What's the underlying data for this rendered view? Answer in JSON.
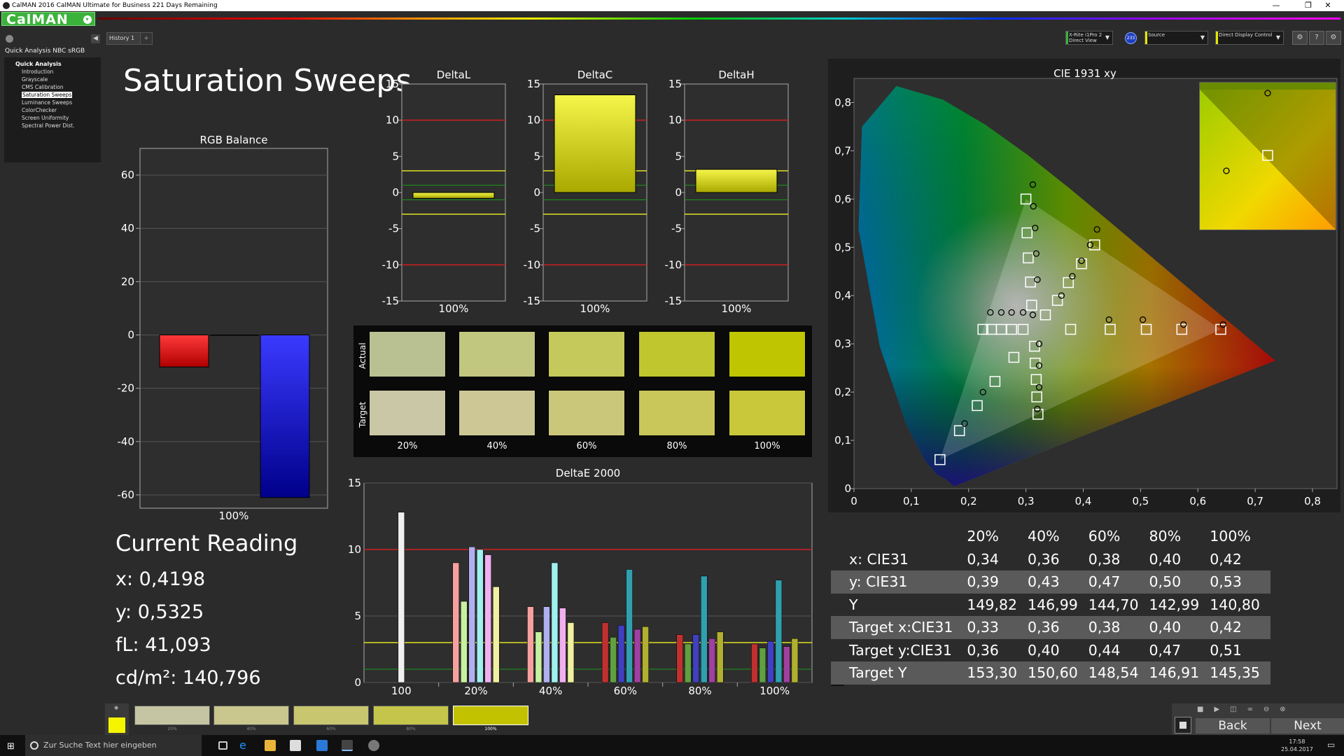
{
  "window": {
    "title": "CalMAN 2016 CalMAN Ultimate for Business 221 Days Remaining",
    "min": "—",
    "max": "❐",
    "close": "✕"
  },
  "logo": {
    "text": "CalMAN",
    "dropdown": "▾"
  },
  "toolbar": {
    "history_tab": "History 1",
    "add_tab": "+",
    "meter_line1": "X-Rite i1Pro 2",
    "meter_line2": "Direct View",
    "meter_badge": "233",
    "source_label": "Source",
    "display_label": "Direct Display Control",
    "meter_color": "#3bb33b",
    "source_color": "#e6e600",
    "display_color": "#e6e600"
  },
  "sidebar": {
    "project": "Quick Analysis NBC sRGB",
    "section": "Quick Analysis",
    "items": [
      "Introduction",
      "Grayscale",
      "CMS Calibration",
      "Saturation Sweeps",
      "Luminance Sweeps",
      "ColorChecker",
      "Screen Uniformity",
      "Spectral Power Dist."
    ],
    "selected_index": 3
  },
  "page": {
    "title": "Saturation Sweeps"
  },
  "rgb_balance": {
    "title": "RGB Balance",
    "xlabel": "100%",
    "ticks": [
      "60",
      "40",
      "20",
      "0",
      "-20",
      "-40",
      "-60"
    ]
  },
  "delta_l": {
    "title": "DeltaL",
    "xlabel": "100%"
  },
  "delta_c": {
    "title": "DeltaC",
    "xlabel": "100%"
  },
  "delta_h": {
    "title": "DeltaH",
    "xlabel": "100%"
  },
  "delta_ticks": [
    "15",
    "10",
    "5",
    "0",
    "-5",
    "-10",
    "-15"
  ],
  "swatches": {
    "actual_label": "Actual",
    "target_label": "Target",
    "labels": [
      "20%",
      "40%",
      "60%",
      "80%",
      "100%"
    ],
    "actual": [
      "#b9c193",
      "#c2c77f",
      "#c5c85a",
      "#c0c62e",
      "#bfc500"
    ],
    "target": [
      "#c9c7a5",
      "#cdc795",
      "#cbc77a",
      "#c9c759",
      "#c8c83a"
    ]
  },
  "deltae": {
    "title": "DeltaE 2000",
    "ticks": [
      "15",
      "10",
      "5",
      "0"
    ],
    "xlabels": [
      "100",
      "20%",
      "40%",
      "60%",
      "80%",
      "100%"
    ]
  },
  "cie": {
    "title": "CIE 1931 xy",
    "xticks": [
      "0",
      "0,1",
      "0,2",
      "0,3",
      "0,4",
      "0,5",
      "0,6",
      "0,7",
      "0,8"
    ],
    "yticks": [
      "0,8",
      "0,7",
      "0,6",
      "0,5",
      "0,4",
      "0,3",
      "0,2",
      "0,1",
      "0"
    ]
  },
  "current_reading": {
    "heading": "Current Reading",
    "x": "x: 0,4198",
    "y": "y: 0,5325",
    "fl": "fL: 41,093",
    "cdm2": "cd/m²: 140,796"
  },
  "table": {
    "headers": [
      "20%",
      "40%",
      "60%",
      "80%",
      "100%"
    ],
    "rows": [
      {
        "label": "x: CIE31",
        "values": [
          "0,34",
          "0,36",
          "0,38",
          "0,40",
          "0,42"
        ]
      },
      {
        "label": "y: CIE31",
        "values": [
          "0,39",
          "0,43",
          "0,47",
          "0,50",
          "0,53"
        ]
      },
      {
        "label": "Y",
        "values": [
          "149,82",
          "146,99",
          "144,70",
          "142,99",
          "140,80"
        ]
      },
      {
        "label": "Target x:CIE31",
        "values": [
          "0,33",
          "0,36",
          "0,38",
          "0,40",
          "0,42"
        ]
      },
      {
        "label": "Target y:CIE31",
        "values": [
          "0,36",
          "0,40",
          "0,44",
          "0,47",
          "0,51"
        ]
      },
      {
        "label": "Target Y",
        "values": [
          "153,30",
          "150,60",
          "148,54",
          "146,91",
          "145,35"
        ]
      }
    ]
  },
  "bottom": {
    "swatch_labels": [
      "20%",
      "40%",
      "60%",
      "80%",
      "100%"
    ],
    "swatch_colors": [
      "#c5c5a3",
      "#c9c68e",
      "#c8c66e",
      "#c5c54b",
      "#c2c200"
    ],
    "current_color": "#f5f500",
    "back": "Back",
    "next": "Next"
  },
  "taskbar": {
    "search_placeholder": "Zur Suche Text hier eingeben",
    "time": "17:58",
    "date": "25.04.2017"
  },
  "chart_data": [
    {
      "type": "bar",
      "title": "RGB Balance",
      "categories": [
        "100%"
      ],
      "series": [
        {
          "name": "Red",
          "values": [
            -12
          ]
        },
        {
          "name": "Green",
          "values": [
            0
          ]
        },
        {
          "name": "Blue",
          "values": [
            -61
          ]
        }
      ],
      "ylim": [
        -65,
        70
      ]
    },
    {
      "type": "bar",
      "title": "DeltaL",
      "categories": [
        "100%"
      ],
      "values": [
        -0.8
      ],
      "ylim": [
        -15,
        15
      ]
    },
    {
      "type": "bar",
      "title": "DeltaC",
      "categories": [
        "100%"
      ],
      "values": [
        13.5
      ],
      "ylim": [
        -15,
        15
      ]
    },
    {
      "type": "bar",
      "title": "DeltaH",
      "categories": [
        "100%"
      ],
      "values": [
        3.2
      ],
      "ylim": [
        -15,
        15
      ]
    },
    {
      "type": "bar",
      "title": "DeltaE 2000",
      "categories": [
        "100",
        "20%",
        "40%",
        "60%",
        "80%",
        "100%"
      ],
      "series": [
        {
          "name": "White",
          "values": [
            12.8,
            null,
            null,
            null,
            null,
            null
          ]
        },
        {
          "name": "Red",
          "values": [
            null,
            9,
            5.7,
            4.5,
            3.6,
            2.9
          ]
        },
        {
          "name": "Green",
          "values": [
            null,
            6.1,
            3.8,
            3.4,
            2.9,
            2.6
          ]
        },
        {
          "name": "Blue",
          "values": [
            null,
            10.2,
            5.7,
            4.3,
            3.6,
            3.1
          ]
        },
        {
          "name": "Cyan",
          "values": [
            null,
            10,
            9,
            8.5,
            8,
            7.7
          ]
        },
        {
          "name": "Magenta",
          "values": [
            null,
            9.6,
            5.6,
            4,
            3.3,
            2.7
          ]
        },
        {
          "name": "Yellow",
          "values": [
            null,
            7.2,
            4.5,
            4.2,
            3.8,
            3.3
          ]
        }
      ],
      "ylim": [
        0,
        15
      ]
    },
    {
      "type": "scatter",
      "title": "CIE 1931 xy",
      "xlim": [
        0,
        0.8
      ],
      "ylim": [
        0,
        0.85
      ],
      "gamut": [
        [
          0.64,
          0.33
        ],
        [
          0.3,
          0.6
        ],
        [
          0.15,
          0.06
        ]
      ],
      "targets": [
        [
          0.64,
          0.33
        ],
        [
          0.572,
          0.33
        ],
        [
          0.51,
          0.33
        ],
        [
          0.447,
          0.33
        ],
        [
          0.378,
          0.33
        ],
        [
          0.3,
          0.6
        ],
        [
          0.302,
          0.53
        ],
        [
          0.304,
          0.478
        ],
        [
          0.308,
          0.428
        ],
        [
          0.31,
          0.38
        ],
        [
          0.15,
          0.06
        ],
        [
          0.184,
          0.12
        ],
        [
          0.215,
          0.172
        ],
        [
          0.246,
          0.222
        ],
        [
          0.279,
          0.272
        ],
        [
          0.42,
          0.505
        ],
        [
          0.397,
          0.466
        ],
        [
          0.374,
          0.427
        ],
        [
          0.355,
          0.39
        ],
        [
          0.334,
          0.36
        ],
        [
          0.225,
          0.33
        ],
        [
          0.24,
          0.33
        ],
        [
          0.257,
          0.33
        ],
        [
          0.275,
          0.33
        ],
        [
          0.295,
          0.33
        ],
        [
          0.321,
          0.154
        ],
        [
          0.319,
          0.19
        ],
        [
          0.318,
          0.226
        ],
        [
          0.316,
          0.26
        ],
        [
          0.315,
          0.295
        ]
      ],
      "measured": [
        [
          0.644,
          0.34
        ],
        [
          0.575,
          0.34
        ],
        [
          0.504,
          0.35
        ],
        [
          0.445,
          0.35
        ],
        [
          0.312,
          0.63
        ],
        [
          0.313,
          0.585
        ],
        [
          0.316,
          0.54
        ],
        [
          0.318,
          0.487
        ],
        [
          0.32,
          0.433
        ],
        [
          0.312,
          0.36
        ],
        [
          0.193,
          0.135
        ],
        [
          0.225,
          0.2
        ],
        [
          0.424,
          0.537
        ],
        [
          0.412,
          0.505
        ],
        [
          0.397,
          0.472
        ],
        [
          0.381,
          0.44
        ],
        [
          0.362,
          0.4
        ],
        [
          0.238,
          0.365
        ],
        [
          0.257,
          0.365
        ],
        [
          0.275,
          0.365
        ],
        [
          0.295,
          0.365
        ],
        [
          0.32,
          0.165
        ],
        [
          0.323,
          0.21
        ],
        [
          0.323,
          0.255
        ],
        [
          0.323,
          0.3
        ]
      ]
    }
  ]
}
